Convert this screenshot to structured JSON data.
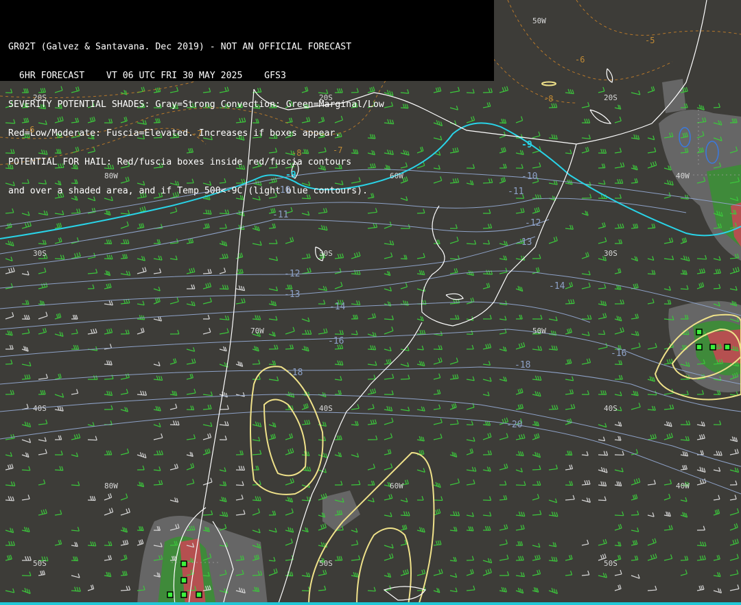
{
  "header": {
    "line1": "GR02T (Galvez & Santavana. Dec 2019) - NOT AN OFFICIAL FORECAST",
    "line2": "  6HR FORECAST    VT 06 UTC FRI 30 MAY 2025    GFS3",
    "line3": "SEVERITY POTENTIAL SHADES: Gray=Strong Convection: Green=Marginal/Low",
    "line4": "Red=Low/Moderate: Fuscia=Elevated. Increases if boxes appear.",
    "line5": "POTENTIAL FOR HAIL: Red/fuscia boxes inside red/fuscia contours",
    "line6": "and over a shaded area, and if Temp 500<-9C (light blue contours)."
  },
  "grid_labels": {
    "lat20_a": "20S",
    "lat20_b": "20S",
    "lat20_c": "20S",
    "lat30_a": "30S",
    "lat30_b": "30S",
    "lat30_c": "30S",
    "lat40_a": "40S",
    "lat40_b": "40S",
    "lat40_c": "40S",
    "lat50_a": "50S",
    "lat50_b": "50S",
    "lat50_c": "50S",
    "lon80_a": "80W",
    "lon80_b": "80W",
    "lon70_a": "70W",
    "lon60_a": "60W",
    "lon60_b": "60W",
    "lon50_a": "50W",
    "lon50_b": "50W",
    "lon40_a": "40W",
    "lon40_b": "40W"
  },
  "temp_labels": {
    "m9_a": "-9",
    "m9_b": "-9",
    "m10_a": "-10",
    "m10_b": "-10",
    "m11_a": "-11",
    "m11_b": "-11",
    "m12_a": "-12",
    "m12_b": "-12",
    "m13_a": "-13",
    "m13_b": "-13",
    "m14_a": "-14",
    "m14_b": "-14",
    "m16_a": "-16",
    "m16_b": "-16",
    "m18_a": "-18",
    "m18_b": "-18",
    "m20": "-20"
  },
  "other_labels": {
    "o5": "-5",
    "o6a": "-6",
    "o6b": "-6",
    "o7a": "-7",
    "o7b": "-7",
    "o8a": "-8",
    "o8b": "-8"
  },
  "colors": {
    "background": "#3d3c38",
    "coast": "#ffffff",
    "temp_contour": "#8ea2c8",
    "minus9_contour": "#29d4e8",
    "severity_gray": "#6a6a6c",
    "severity_green": "#3f8a3a",
    "severity_red": "#b55050",
    "yellow_contour": "#f0e28a",
    "wind_barb": "#3cc83c"
  }
}
